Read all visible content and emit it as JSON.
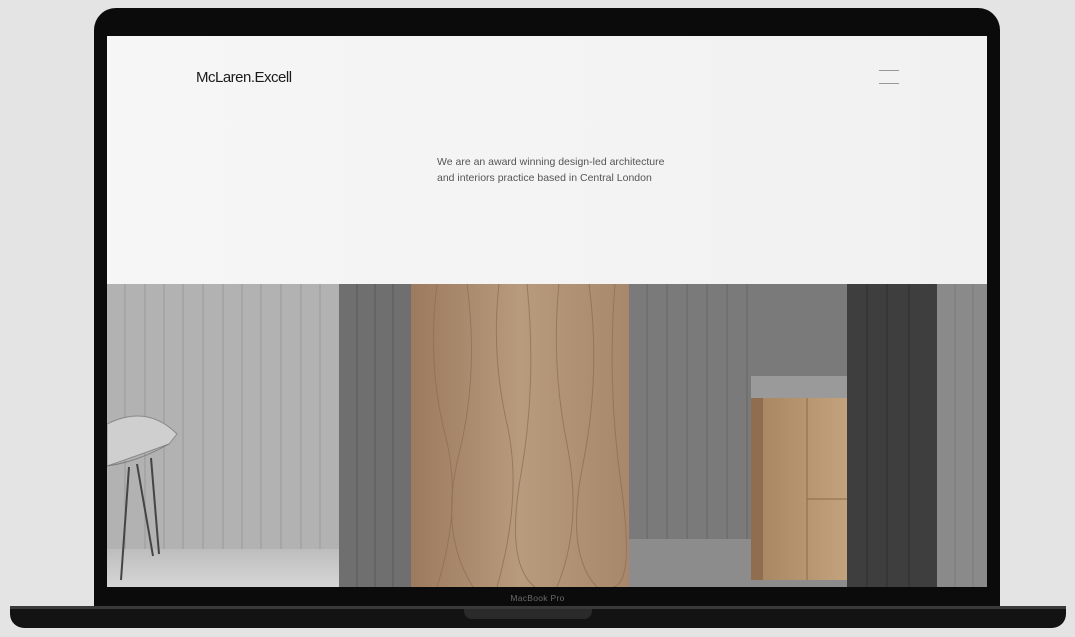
{
  "device": {
    "label": "MacBook Pro"
  },
  "site": {
    "logo": "McLaren.Excell",
    "tagline_lines": [
      "We are an award winning design-led architecture",
      "and interiors practice based in Central London"
    ]
  },
  "colors": {
    "background": "#e4e4e4",
    "bezel": "#0b0b0b",
    "page": "#f5f5f5",
    "text": "#1b1b1b"
  },
  "icons": {
    "menu": "hamburger-menu-icon"
  }
}
